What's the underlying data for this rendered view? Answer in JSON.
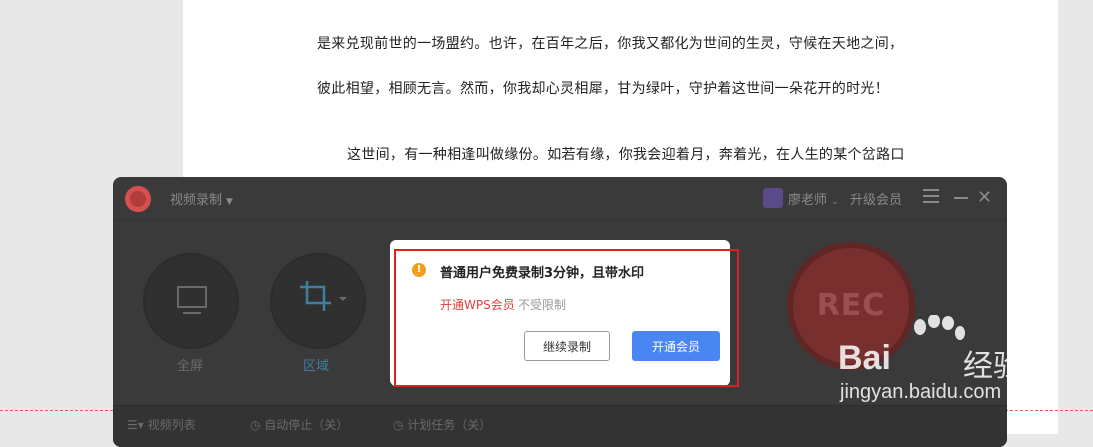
{
  "document": {
    "lines": [
      "是来兑现前世的一场盟约。也许，在百年之后，你我又都化为世间的生灵，守候在天地之间，",
      "彼此相望，相顾无言。然而，你我却心灵相犀，甘为绿叶，守护着这世间一朵花开的时光！",
      "这世间，有一种相逢叫做缘份。如若有缘，你我会迎着月，奔着光，在人生的某个岔路口"
    ]
  },
  "recorder": {
    "title": "视频录制",
    "user_name": "廖老师",
    "upgrade_label": "升级会员",
    "mode_fullscreen": "全屏",
    "mode_region": "区域",
    "rec_label": "REC",
    "bottom": {
      "video_list": "视频列表",
      "auto_stop": "自动停止（关）",
      "scheduled_task": "计划任务（关）"
    }
  },
  "modal": {
    "title": "普通用户免费录制3分钟，且带水印",
    "link_text": "开通WPS会员",
    "sub_text": "不受限制",
    "continue_label": "继续录制",
    "open_label": "开通会员",
    "warn_glyph": "!"
  },
  "watermark": {
    "brand": "Bai",
    "brand_cn": "经验",
    "url": "jingyan.baidu.com"
  },
  "colors": {
    "accent_blue": "#4a86f2",
    "link_red": "#e23d3d",
    "highlight_red": "#e02020",
    "warning_orange": "#f0a020"
  }
}
